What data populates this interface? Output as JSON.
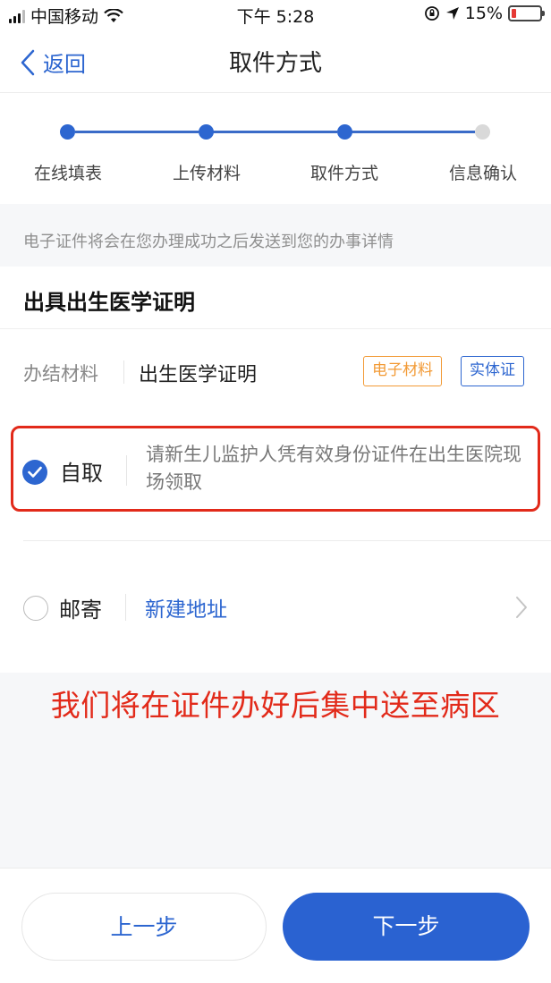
{
  "status_bar": {
    "carrier": "中国移动",
    "time": "下午 5:28",
    "battery_percent": "15%",
    "battery_level": 0.15
  },
  "nav": {
    "back_label": "返回",
    "title": "取件方式"
  },
  "stepper": {
    "steps": [
      {
        "label": "在线填表",
        "status": "done"
      },
      {
        "label": "上传材料",
        "status": "done"
      },
      {
        "label": "取件方式",
        "status": "current"
      },
      {
        "label": "信息确认",
        "status": "pending"
      }
    ],
    "active_color": "#2d66d0",
    "pending_color": "#d9d9d9"
  },
  "notice": "电子证件将会在您办理成功之后发送到您的办事详情",
  "section": {
    "title": "出具出生医学证明",
    "material_label": "办结材料",
    "material_value": "出生医学证明",
    "tags": [
      "电子材料",
      "实体证"
    ]
  },
  "pickup": {
    "self_label": "自取",
    "self_desc": "请新生儿监护人凭有效身份证件在出生医院现场领取",
    "self_selected": true,
    "mail_label": "邮寄",
    "mail_selected": false,
    "new_address": "新建地址"
  },
  "overlay_note": "我们将在证件办好后集中送至病区",
  "buttons": {
    "prev": "上一步",
    "next": "下一步"
  },
  "colors": {
    "primary": "#2a62d1",
    "highlight_border": "#e22a1a",
    "tag_orange": "#f29a35"
  }
}
